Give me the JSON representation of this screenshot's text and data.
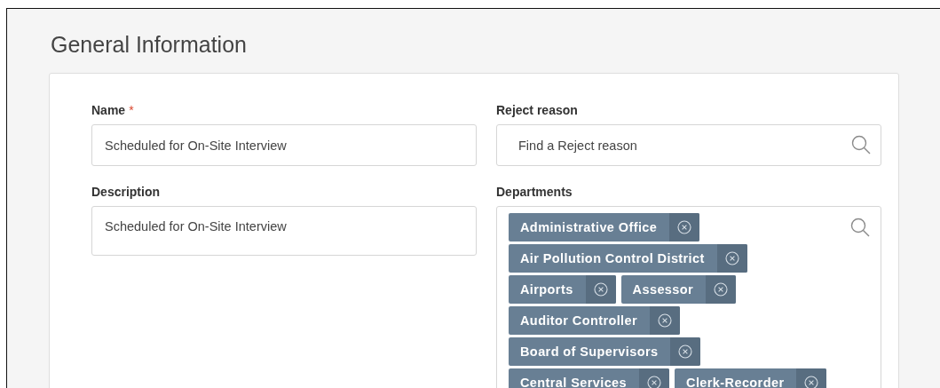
{
  "section": {
    "title": "General Information"
  },
  "fields": [
    {
      "kind": "text",
      "label": "Name",
      "required_mark": "*",
      "value": "Scheduled for On-Site Interview"
    },
    {
      "kind": "search",
      "label": "Reject reason",
      "placeholder": "Find a Reject reason"
    },
    {
      "kind": "textarea",
      "label": "Description",
      "value": "Scheduled for On-Site Interview"
    },
    {
      "kind": "tags",
      "label": "Departments",
      "tags": [
        "Administrative Office",
        "Air Pollution Control District",
        "Airports",
        "Assessor",
        "Auditor Controller",
        "Board of Supervisors",
        "Central Services",
        "Clerk-Recorder"
      ]
    }
  ]
}
